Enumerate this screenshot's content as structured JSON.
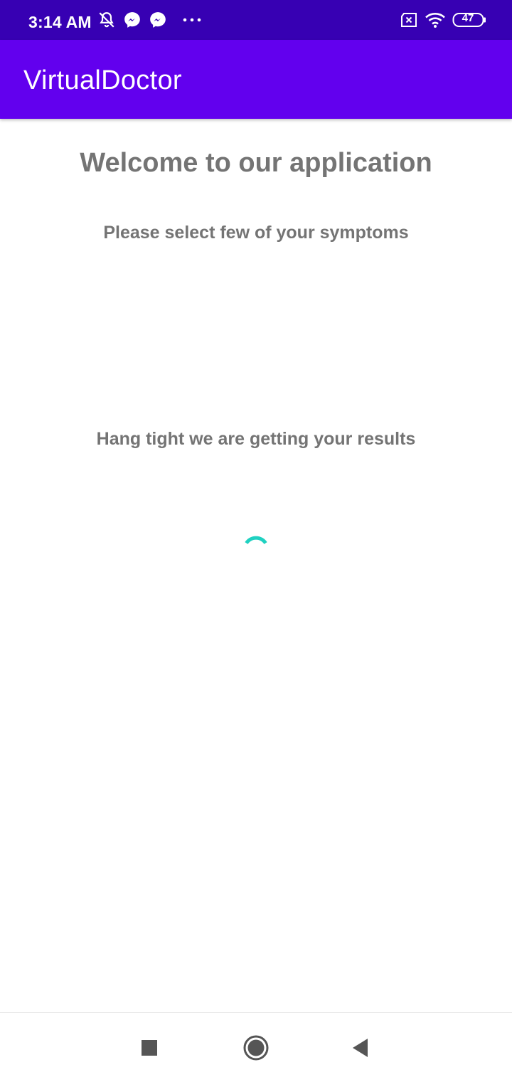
{
  "status_bar": {
    "time": "3:14 AM",
    "battery": "47",
    "background_color": "#3700b3",
    "icons": [
      "notifications-off-icon",
      "messenger-icon",
      "messenger-icon",
      "more-dots-icon",
      "sim-x-icon",
      "wifi-icon",
      "battery-icon"
    ]
  },
  "app_bar": {
    "title": "VirtualDoctor",
    "background_color": "#6200ee"
  },
  "main": {
    "welcome_text": "Welcome to our application",
    "instruction_text": "Please select few of your symptoms",
    "loading_text": "Hang tight we are getting your results",
    "spinner_color": "#1fd1c1",
    "text_color": "#747474"
  },
  "nav_bar": {
    "icons": [
      "recent-apps-icon",
      "home-icon",
      "back-icon"
    ]
  }
}
